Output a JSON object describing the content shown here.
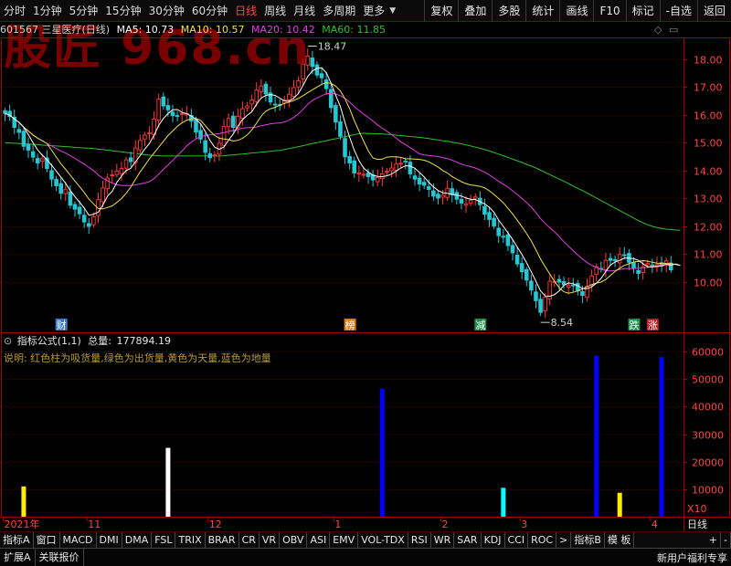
{
  "toolbar": {
    "periods": [
      "分时",
      "1分钟",
      "5分钟",
      "15分钟",
      "30分钟",
      "60分钟",
      "日线",
      "周线",
      "月线",
      "多周期",
      "更多"
    ],
    "selected_period": "日线",
    "actions": [
      "复权",
      "叠加",
      "多股",
      "统计",
      "画线",
      "F10",
      "标记",
      "-自选",
      "返回"
    ]
  },
  "stock": {
    "code_name": "601567 三星医疗(日线)",
    "ma5": "MA5: 10.73",
    "ma10": "MA10: 10.57",
    "ma20": "MA20: 10.42",
    "ma60": "MA60: 11.85",
    "watermark": "股匠 968.cn"
  },
  "colors": {
    "bg": "#000000",
    "border": "#a00000",
    "up": "#ff3b3b",
    "down": "#27c7d2",
    "ma5": "#ffffff",
    "ma10": "#f0e050",
    "ma20": "#e040e0",
    "ma60": "#30c030",
    "axis_text": "#ff4444",
    "grid": "#6a0000"
  },
  "markers": {
    "high": "18.47",
    "low": "8.54",
    "events": [
      {
        "label": "财",
        "color": "#3a78c8",
        "bar": 12
      },
      {
        "label": "榜",
        "color": "#d87a1a",
        "bar": 74
      },
      {
        "label": "减",
        "color": "#1e8e4a",
        "bar": 102
      },
      {
        "label": "跌",
        "color": "#1e8e4a",
        "bar": 135
      },
      {
        "label": "涨",
        "color": "#c01e1e",
        "bar": 139
      }
    ]
  },
  "indicator": {
    "name": "指标公式(1,1)",
    "total_label": "总量:",
    "total_value": "177894.19",
    "description": "说明: 红色柱为吸货量,绿色为出货量,黄色为天量,蓝色为地量",
    "multiplier": "X10"
  },
  "chart_data": [
    {
      "type": "candlestick",
      "title": "601567 三星医疗(日线)",
      "y_ticks": [
        10.0,
        11.0,
        12.0,
        13.0,
        14.0,
        15.0,
        16.0,
        17.0,
        18.0
      ],
      "ylim": [
        8.25,
        18.75
      ],
      "bar_count": 146,
      "close": [
        16.05,
        15.94,
        15.55,
        15.37,
        14.87,
        14.73,
        14.48,
        14.27,
        14.42,
        14.07,
        13.69,
        13.45,
        13.18,
        13.31,
        12.75,
        12.61,
        12.44,
        12.15,
        11.99,
        12.34,
        12.95,
        13.37,
        13.73,
        13.85,
        13.97,
        14.07,
        14.38,
        14.32,
        14.81,
        15.08,
        15.27,
        15.35,
        15.85,
        16.57,
        16.32,
        16.18,
        15.97,
        15.94,
        16.05,
        16.05,
        15.78,
        15.38,
        15.13,
        14.65,
        14.46,
        14.56,
        14.98,
        15.58,
        15.87,
        15.55,
        15.95,
        16.22,
        16.32,
        16.53,
        16.89,
        17.04,
        16.75,
        16.46,
        16.38,
        16.35,
        16.54,
        16.74,
        16.98,
        17.22,
        17.83,
        18.11,
        17.74,
        17.43,
        17.33,
        16.94,
        16.26,
        15.74,
        15.23,
        14.49,
        14.27,
        13.91,
        13.92,
        13.86,
        13.78,
        13.66,
        13.75,
        13.88,
        13.97,
        14.09,
        14.23,
        14.26,
        14.32,
        13.88,
        13.69,
        13.51,
        13.47,
        13.32,
        13.08,
        13.01,
        13.11,
        13.36,
        13.13,
        12.97,
        12.83,
        12.8,
        12.93,
        13.05,
        12.77,
        12.43,
        12.24,
        12.0,
        11.66,
        11.61,
        11.3,
        11.04,
        10.64,
        10.36,
        10.06,
        9.7,
        9.32,
        8.9,
        9.45,
        10.02,
        10.01,
        9.99,
        9.89,
        9.88,
        9.86,
        9.67,
        9.51,
        9.84,
        10.21,
        10.54,
        10.48,
        10.77,
        10.77,
        10.76,
        10.98,
        10.94,
        10.7,
        10.48,
        10.3,
        10.54,
        10.66,
        10.59,
        10.62,
        10.57,
        10.75,
        10.43
      ],
      "ma5": [
        16.05,
        15.99,
        15.85,
        15.73,
        15.56,
        15.29,
        15.0,
        14.74,
        14.55,
        14.39,
        14.19,
        13.98,
        13.76,
        13.54,
        13.28,
        13.06,
        12.86,
        12.65,
        12.39,
        12.43,
        12.5,
        12.76,
        13.08,
        13.25,
        13.57,
        13.8,
        14.0,
        14.08,
        14.31,
        14.53,
        14.77,
        14.97,
        15.27,
        15.62,
        15.87,
        16.05,
        16.18,
        16.19,
        16.09,
        16.04,
        15.96,
        15.84,
        15.68,
        15.4,
        15.08,
        14.84,
        14.76,
        14.85,
        15.09,
        15.31,
        15.59,
        15.83,
        15.98,
        16.11,
        16.38,
        16.6,
        16.7,
        16.73,
        16.7,
        16.6,
        16.5,
        16.49,
        16.6,
        16.77,
        17.06,
        17.38,
        17.58,
        17.67,
        17.69,
        17.51,
        17.14,
        16.7,
        16.3,
        15.73,
        15.2,
        14.73,
        14.36,
        14.09,
        13.95,
        13.83,
        13.79,
        13.78,
        13.81,
        13.87,
        13.98,
        14.09,
        14.17,
        14.16,
        14.08,
        13.93,
        13.77,
        13.57,
        13.41,
        13.28,
        13.2,
        13.18,
        13.14,
        13.12,
        13.08,
        13.01,
        12.97,
        12.96,
        12.88,
        12.8,
        12.68,
        12.5,
        12.22,
        11.99,
        11.76,
        11.52,
        11.25,
        10.98,
        10.68,
        10.36,
        10.02,
        9.67,
        9.49,
        9.48,
        9.54,
        9.67,
        9.87,
        9.96,
        9.93,
        9.86,
        9.76,
        9.75,
        9.82,
        9.95,
        10.12,
        10.37,
        10.6,
        10.71,
        10.77,
        10.85,
        10.85,
        10.83,
        10.77,
        10.65,
        10.54,
        10.53,
        10.56,
        10.57,
        10.63,
        10.6,
        10.64,
        10.59
      ],
      "ma10": [
        16.05,
        15.99,
        15.85,
        15.73,
        15.56,
        15.42,
        15.28,
        15.16,
        15.07,
        14.97,
        14.73,
        14.48,
        14.24,
        14.04,
        13.83,
        13.62,
        13.42,
        13.21,
        12.97,
        12.8,
        12.63,
        12.62,
        12.67,
        12.73,
        12.85,
        12.99,
        13.18,
        13.4,
        13.68,
        13.95,
        14.18,
        14.42,
        14.63,
        14.84,
        15.05,
        15.26,
        15.42,
        15.59,
        15.71,
        15.81,
        15.86,
        15.87,
        15.8,
        15.61,
        15.42,
        15.26,
        15.16,
        15.13,
        15.11,
        15.06,
        15.08,
        15.16,
        15.28,
        15.46,
        15.7,
        15.95,
        16.13,
        16.22,
        16.27,
        16.35,
        16.41,
        16.46,
        16.52,
        16.59,
        16.69,
        16.8,
        16.9,
        17.0,
        17.1,
        17.16,
        17.13,
        17.03,
        16.86,
        16.58,
        16.22,
        15.8,
        15.42,
        15.06,
        14.71,
        14.45,
        14.4,
        14.41,
        14.48,
        14.49,
        14.49,
        14.47,
        14.42,
        14.42,
        14.41,
        14.4,
        14.37,
        14.31,
        14.22,
        14.12,
        14.0,
        13.91,
        13.78,
        13.69,
        13.6,
        13.53,
        13.48,
        13.46,
        13.43,
        13.38,
        13.27,
        13.14,
        12.99,
        12.84,
        12.64,
        12.44,
        12.21,
        11.98,
        11.73,
        11.47,
        11.15,
        10.82,
        10.54,
        10.27,
        10.01,
        9.79,
        9.64,
        9.59,
        9.62,
        9.67,
        9.74,
        9.82,
        9.9,
        9.95,
        9.99,
        10.08,
        10.23,
        10.37,
        10.49,
        10.59,
        10.65,
        10.71,
        10.73,
        10.76,
        10.74,
        10.7,
        10.67,
        10.66,
        10.66,
        10.65,
        10.62,
        10.59
      ],
      "ma20": [
        16.05,
        15.99,
        15.85,
        15.73,
        15.56,
        15.42,
        15.28,
        15.16,
        15.07,
        14.97,
        14.88,
        14.79,
        14.7,
        14.63,
        14.53,
        14.44,
        14.33,
        14.23,
        14.11,
        14.0,
        13.84,
        13.72,
        13.63,
        13.55,
        13.49,
        13.46,
        13.46,
        13.46,
        13.48,
        13.52,
        13.55,
        13.6,
        13.71,
        13.87,
        14.04,
        14.2,
        14.36,
        14.53,
        14.7,
        14.88,
        15.02,
        15.14,
        15.22,
        15.26,
        15.28,
        15.3,
        15.33,
        15.36,
        15.41,
        15.44,
        15.47,
        15.52,
        15.54,
        15.54,
        15.56,
        15.61,
        15.64,
        15.68,
        15.7,
        15.71,
        15.74,
        15.81,
        15.91,
        16.04,
        16.2,
        16.38,
        16.52,
        16.61,
        16.69,
        16.76,
        16.77,
        16.75,
        16.69,
        16.59,
        16.46,
        16.3,
        16.16,
        16.03,
        15.91,
        15.78,
        15.64,
        15.52,
        15.41,
        15.29,
        15.16,
        15.03,
        14.93,
        14.82,
        14.71,
        14.6,
        14.56,
        14.54,
        14.52,
        14.5,
        14.46,
        14.43,
        14.37,
        14.3,
        14.23,
        14.18,
        14.14,
        14.09,
        14.02,
        13.94,
        13.84,
        13.73,
        13.61,
        13.51,
        13.4,
        13.27,
        13.14,
        13.0,
        12.85,
        12.68,
        12.49,
        12.27,
        12.1,
        11.94,
        11.79,
        11.63,
        11.44,
        11.28,
        11.12,
        10.96,
        10.82,
        10.69,
        10.59,
        10.51,
        10.45,
        10.4,
        10.39,
        10.41,
        10.44,
        10.47,
        10.48,
        10.47,
        10.49,
        10.49,
        10.52,
        10.55,
        10.57,
        10.6,
        10.62,
        10.58
      ],
      "ma60": [
        15.0,
        14.99,
        14.98,
        14.97,
        14.96,
        14.95,
        14.94,
        14.93,
        14.91,
        14.9,
        14.89,
        14.88,
        14.87,
        14.86,
        14.85,
        14.83,
        14.82,
        14.81,
        14.8,
        14.79,
        14.77,
        14.75,
        14.73,
        14.71,
        14.69,
        14.67,
        14.65,
        14.63,
        14.61,
        14.59,
        14.57,
        14.55,
        14.54,
        14.53,
        14.52,
        14.52,
        14.52,
        14.52,
        14.52,
        14.52,
        14.52,
        14.52,
        14.52,
        14.52,
        14.52,
        14.52,
        14.52,
        14.53,
        14.55,
        14.56,
        14.58,
        14.59,
        14.61,
        14.63,
        14.64,
        14.66,
        14.67,
        14.69,
        14.71,
        14.72,
        14.75,
        14.79,
        14.82,
        14.86,
        14.89,
        14.93,
        14.97,
        15.0,
        15.04,
        15.07,
        15.11,
        15.14,
        15.18,
        15.22,
        15.25,
        15.29,
        15.32,
        15.34,
        15.33,
        15.33,
        15.32,
        15.31,
        15.3,
        15.29,
        15.27,
        15.26,
        15.24,
        15.22,
        15.21,
        15.19,
        15.17,
        15.15,
        15.12,
        15.1,
        15.07,
        15.05,
        15.02,
        14.99,
        14.96,
        14.92,
        14.88,
        14.84,
        14.8,
        14.75,
        14.7,
        14.65,
        14.59,
        14.53,
        14.47,
        14.41,
        14.35,
        14.29,
        14.22,
        14.16,
        14.09,
        14.01,
        13.93,
        13.85,
        13.77,
        13.69,
        13.61,
        13.53,
        13.44,
        13.36,
        13.28,
        13.19,
        13.1,
        13.01,
        12.92,
        12.83,
        12.74,
        12.65,
        12.56,
        12.47,
        12.38,
        12.29,
        12.2,
        12.12,
        12.05,
        11.99,
        11.95,
        11.92,
        11.89,
        11.88,
        11.86,
        11.85
      ]
    },
    {
      "type": "bar",
      "title": "指标公式(1,1)",
      "y_ticks": [
        10000,
        20000,
        30000,
        40000,
        50000,
        60000
      ],
      "ylim": [
        0,
        64000
      ],
      "bars": [
        {
          "bar": 4,
          "value": 11000,
          "color": "#ffee00"
        },
        {
          "bar": 35,
          "value": 25000,
          "color": "#ffffff"
        },
        {
          "bar": 81,
          "value": 46500,
          "color": "#0000ff"
        },
        {
          "bar": 107,
          "value": 10500,
          "color": "#00ffff"
        },
        {
          "bar": 127,
          "value": 58500,
          "color": "#0000ff"
        },
        {
          "bar": 132,
          "value": 8700,
          "color": "#ffee00"
        },
        {
          "bar": 141,
          "value": 58000,
          "color": "#0000ff"
        }
      ]
    }
  ],
  "time_axis": {
    "labels": [
      {
        "text": "2021年",
        "bar": 0
      },
      {
        "text": "11",
        "bar": 18
      },
      {
        "text": "12",
        "bar": 44
      },
      {
        "text": "1",
        "bar": 71
      },
      {
        "text": "2",
        "bar": 94
      },
      {
        "text": "3",
        "bar": 111
      },
      {
        "text": "4",
        "bar": 139
      }
    ],
    "period": "日线"
  },
  "indicator_tabs": [
    "指标A",
    "窗口",
    "MACD",
    "DMI",
    "DMA",
    "FSL",
    "TRIX",
    "BRAR",
    "CR",
    "VR",
    "OBV",
    "ASI",
    "EMV",
    "VOL-TDX",
    "RSI",
    "WR",
    "SAR",
    "KDJ",
    "CCI",
    "ROC",
    ">",
    "指标B",
    "模 板",
    "+",
    "-"
  ],
  "bottom_bar": {
    "items": [
      "扩展A",
      "关联报价"
    ],
    "promo": "新用户福利专享"
  }
}
